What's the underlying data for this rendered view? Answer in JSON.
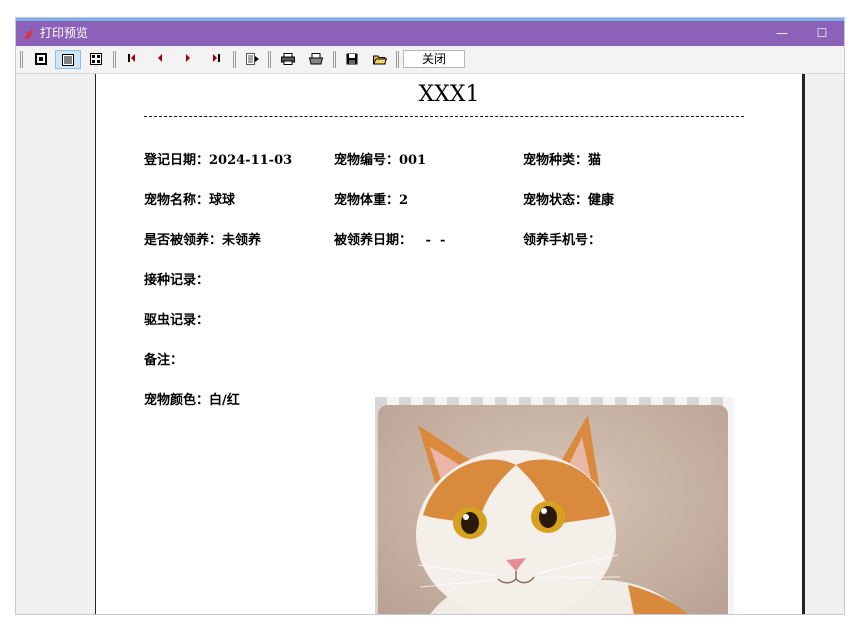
{
  "window": {
    "title": "打印预览"
  },
  "toolbar": {
    "close_label": "关闭"
  },
  "document": {
    "title": "XXX1",
    "fields": {
      "register_date": "登记日期：2024-11-03",
      "pet_id": "宠物编号：001",
      "pet_species": "宠物种类：猫",
      "pet_name": "宠物名称：球球",
      "pet_weight": "宠物体重：2",
      "pet_status": "宠物状态：健康",
      "adopted": "是否被领养：未领养",
      "adopt_date": "被领养日期：   -  -",
      "adopter_phone": "领养手机号：",
      "vaccine_records": "接种记录：",
      "deworm_records": "驱虫记录：",
      "remarks": "备注：",
      "pet_color": "宠物颜色：白/红"
    }
  },
  "colors": {
    "titlebar": "#8b62b8",
    "titlebar_top_line": "#7fb0e8",
    "toolbar_active": "#cfe6f7",
    "cat_orange": "#d98a3c"
  },
  "icons": [
    "single-page-view-icon",
    "multi-line-view-icon",
    "thumbnail-view-icon",
    "first-page-icon",
    "prev-page-icon",
    "next-page-icon",
    "last-page-icon",
    "goto-page-icon",
    "print-setup-icon",
    "print-icon",
    "save-icon",
    "open-folder-icon"
  ],
  "image": {
    "subject": "orange-and-white-cat-photo"
  }
}
